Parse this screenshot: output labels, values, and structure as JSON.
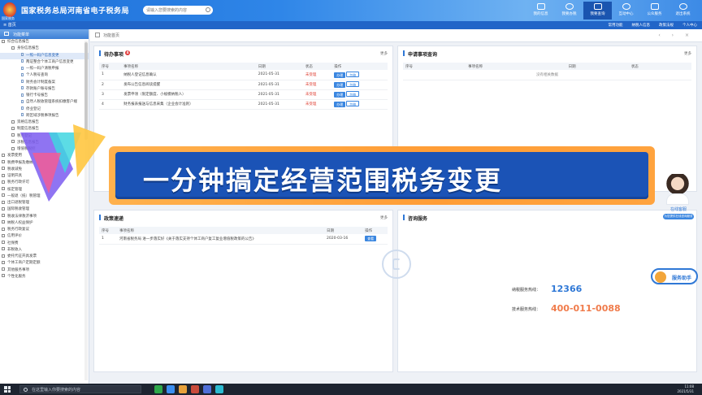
{
  "header": {
    "title": "国家税务总局河南省电子税务局",
    "logo_sub": "国家税务",
    "search_placeholder": "请输入您要搜索的内容",
    "nav": [
      {
        "label": "我的信息",
        "icon": "user-icon"
      },
      {
        "label": "我要办税",
        "icon": "monitor-icon"
      },
      {
        "label": "我要查询",
        "icon": "search-icon"
      },
      {
        "label": "互动中心",
        "icon": "chat-icon"
      },
      {
        "label": "公众服务",
        "icon": "service-icon"
      },
      {
        "label": "退出系统",
        "icon": "power-icon"
      }
    ],
    "active_nav": 2
  },
  "subbar": {
    "tab": "≡ 首页",
    "links": [
      "常用功能",
      "纳税人信息",
      "政策法规",
      "个人中心"
    ]
  },
  "sidebar": {
    "title": "功能菜单",
    "items": [
      {
        "text": "综合信息报告",
        "type": "box",
        "indent": 2
      },
      {
        "text": "身份信息报告",
        "type": "box",
        "indent": 14
      },
      {
        "text": "一照一码户信息变更",
        "type": "doc",
        "indent": 26,
        "selected": true
      },
      {
        "text": "两证整合个体工商户信息变更",
        "type": "doc",
        "indent": 26
      },
      {
        "text": "一照一码户清税申报",
        "type": "doc",
        "indent": 26
      },
      {
        "text": "个人税号查询",
        "type": "doc",
        "indent": 26
      },
      {
        "text": "财务会计制度备案",
        "type": "doc",
        "indent": 26
      },
      {
        "text": "存款账户账号报告",
        "type": "doc",
        "indent": 26
      },
      {
        "text": "银行卡号报告",
        "type": "doc",
        "indent": 26
      },
      {
        "text": "自然人税收管理系统扣缴客户端",
        "type": "doc",
        "indent": 26
      },
      {
        "text": "停业登记",
        "type": "doc",
        "indent": 26
      },
      {
        "text": "跨区域涉税事项报告",
        "type": "doc",
        "indent": 26
      },
      {
        "text": "资格信息报告",
        "type": "box",
        "indent": 14
      },
      {
        "text": "制度信息报告",
        "type": "box",
        "indent": 14
      },
      {
        "text": "税务登记",
        "type": "box",
        "indent": 14
      },
      {
        "text": "涉税信息报告",
        "type": "box",
        "indent": 14
      },
      {
        "text": "增值税税控",
        "type": "box",
        "indent": 14
      },
      {
        "text": "发票使用",
        "type": "box",
        "indent": 2
      },
      {
        "text": "税费申报及缴纳",
        "type": "box",
        "indent": 2
      },
      {
        "text": "税收减免",
        "type": "box",
        "indent": 2
      },
      {
        "text": "证明开具",
        "type": "box",
        "indent": 2
      },
      {
        "text": "税务行政许可",
        "type": "box",
        "indent": 2
      },
      {
        "text": "核定管理",
        "type": "box",
        "indent": 2
      },
      {
        "text": "一般退（抵）税管理",
        "type": "box",
        "indent": 2
      },
      {
        "text": "出口退税管理",
        "type": "box",
        "indent": 2
      },
      {
        "text": "国际税收管理",
        "type": "box",
        "indent": 2
      },
      {
        "text": "税收法律救济事项",
        "type": "box",
        "indent": 2
      },
      {
        "text": "纳税人权益保护",
        "type": "box",
        "indent": 2
      },
      {
        "text": "税务行政复议",
        "type": "box",
        "indent": 2
      },
      {
        "text": "信用评价",
        "type": "box",
        "indent": 2
      },
      {
        "text": "社保费",
        "type": "box",
        "indent": 2
      },
      {
        "text": "非税收入",
        "type": "box",
        "indent": 2
      },
      {
        "text": "委托代征开具发票",
        "type": "box",
        "indent": 2
      },
      {
        "text": "个体工商户定期定额",
        "type": "box",
        "indent": 2
      },
      {
        "text": "其他服务事项",
        "type": "box",
        "indent": 2
      },
      {
        "text": "个性化服务",
        "type": "box",
        "indent": 2
      }
    ]
  },
  "breadcrumb": "功能首页",
  "todo": {
    "title": "待办事项",
    "badge": "4",
    "more": "更多",
    "columns": [
      "序号",
      "事项名称",
      "日期",
      "状态",
      "操作"
    ],
    "rows": [
      {
        "no": "1",
        "name": "纳税人登记信息确认",
        "date": "2021-05-31",
        "status": "未受理"
      },
      {
        "no": "2",
        "name": "发布公告信息阅读提醒",
        "date": "2021-05-31",
        "status": "未受理"
      },
      {
        "no": "3",
        "name": "发票申领（限定额度、小规模纳税人）",
        "date": "2021-05-31",
        "status": "未受理"
      },
      {
        "no": "4",
        "name": "财务报表报送与信息采集（企业会计准则）",
        "date": "2021-05-31",
        "status": "未受理"
      }
    ],
    "action_primary": "办理",
    "action_secondary": "忽略"
  },
  "query": {
    "title": "申请事项查询",
    "more": "更多",
    "columns": [
      "序号",
      "事项名称",
      "日期",
      "状态"
    ],
    "empty": "没有相关数据"
  },
  "policy": {
    "title": "政策速递",
    "more": "更多",
    "columns": [
      "序号",
      "事项名称",
      "日期",
      "操作"
    ],
    "rows": [
      {
        "no": "1",
        "name": "河南省税务局 进一步落实好《关于落实支持个体工商户复工复业增值税政策的公告》",
        "date": "2020-03-16",
        "action": "查看"
      }
    ]
  },
  "consult": {
    "title": "咨询服务",
    "hotline1_label": "纳税服务热线：",
    "hotline1": "12366",
    "hotline2_label": "技术服务热线：",
    "hotline2": "400-011-0088"
  },
  "widgets": {
    "online_service": "在线客服",
    "online_pill": "为您提供在线咨询服务",
    "assistant": "服务助手"
  },
  "banner": {
    "text": "一分钟搞定经营范围税务变更"
  },
  "taskbar": {
    "search_placeholder": "在这里输入你要搜索的内容",
    "time": "11:08",
    "date": "2021/5/31"
  },
  "colors": {
    "brand": "#1d6fd8",
    "banner_orange": "#ff9d36",
    "banner_blue": "#1b53b6",
    "hotline_blue": "#2f78d6",
    "hotline_orange": "#f07c4c",
    "status_red": "#e0463a"
  }
}
